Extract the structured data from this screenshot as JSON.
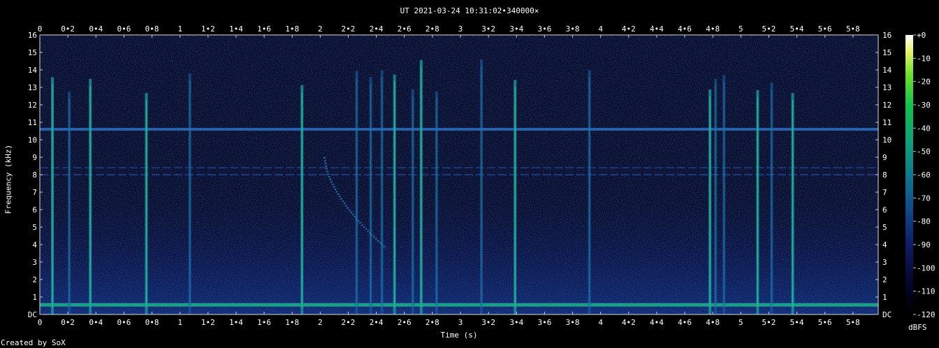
{
  "title": "UT 2021-03-24 10:31:02•340000×",
  "footer": "Created by SoX",
  "colorbar_unit": "dBFS",
  "chart_data": {
    "type": "heatmap",
    "title": "UT 2021-03-24 10:31:02•340000×",
    "xlabel": "Time (s)",
    "ylabel": "Frequency (kHz)",
    "xlim": [
      0,
      5.98
    ],
    "ylim": [
      0,
      16
    ],
    "x_ticks": [
      "0",
      "0•2",
      "0•4",
      "0•6",
      "0•8",
      "1",
      "1•2",
      "1•4",
      "1•6",
      "1•8",
      "2",
      "2•2",
      "2•4",
      "2•6",
      "2•8",
      "3",
      "3•2",
      "3•4",
      "3•6",
      "3•8",
      "4",
      "4•2",
      "4•4",
      "4•6",
      "4•8",
      "5",
      "5•2",
      "5•4",
      "5•6",
      "5•8"
    ],
    "y_ticks": [
      "DC",
      "1",
      "2",
      "3",
      "4",
      "5",
      "6",
      "7",
      "8",
      "9",
      "10",
      "11",
      "12",
      "13",
      "14",
      "15",
      "16"
    ],
    "colorbar": {
      "label": "dBFS",
      "ticks": [
        "+0",
        "-10",
        "-20",
        "-30",
        "-40",
        "-50",
        "-60",
        "-70",
        "-80",
        "-90",
        "-100",
        "-110",
        "-120"
      ],
      "range": [
        -120,
        0
      ]
    },
    "features": {
      "tones_khz": [
        0.55,
        10.6,
        8.0,
        8.4
      ],
      "transient_times_s": [
        0.09,
        0.21,
        0.36,
        0.76,
        1.07,
        1.87,
        2.26,
        2.36,
        2.44,
        2.53,
        2.66,
        2.72,
        2.83,
        3.15,
        3.39,
        3.92,
        4.78,
        4.82,
        4.88,
        5.12,
        5.22,
        5.37
      ],
      "sweep": {
        "start_time_s": 2.03,
        "end_time_s": 2.47,
        "start_khz": 9.0,
        "end_khz": 3.8
      }
    }
  }
}
